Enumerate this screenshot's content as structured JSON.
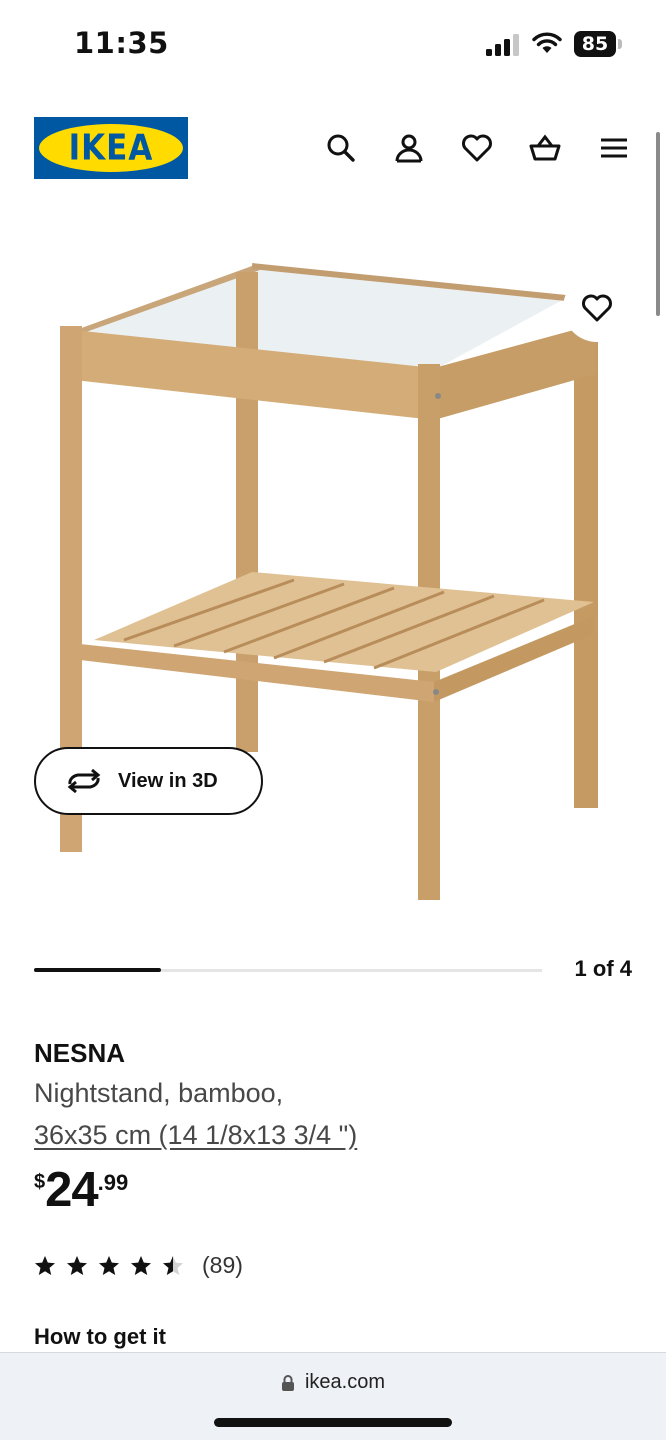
{
  "status_bar": {
    "time": "11:35",
    "battery": "85"
  },
  "header": {
    "logo_text": "IKEA",
    "logo_reg": "®"
  },
  "gallery": {
    "view_3d_label": "View in 3D",
    "counter": "1 of 4",
    "current_index": 1,
    "total": 4
  },
  "product": {
    "name": "NESNA",
    "description": "Nightstand, bamboo,",
    "size": "36x35 cm (14 1/8x13 3/4 \")",
    "price_currency": "$",
    "price_integer": "24",
    "price_decimal": ".99",
    "rating_value": 4.5,
    "rating_max": 5,
    "review_count": "(89)"
  },
  "section": {
    "how_to_get_it": "How to get it"
  },
  "browser": {
    "url": "ikea.com"
  },
  "icons": [
    "search-icon",
    "account-icon",
    "heart-icon",
    "basket-icon",
    "menu-icon",
    "rotate-3d-icon",
    "star-icon",
    "lock-icon"
  ],
  "colors": {
    "ikea_blue": "#0058a3",
    "ikea_yellow": "#ffdb00",
    "text": "#111111"
  }
}
